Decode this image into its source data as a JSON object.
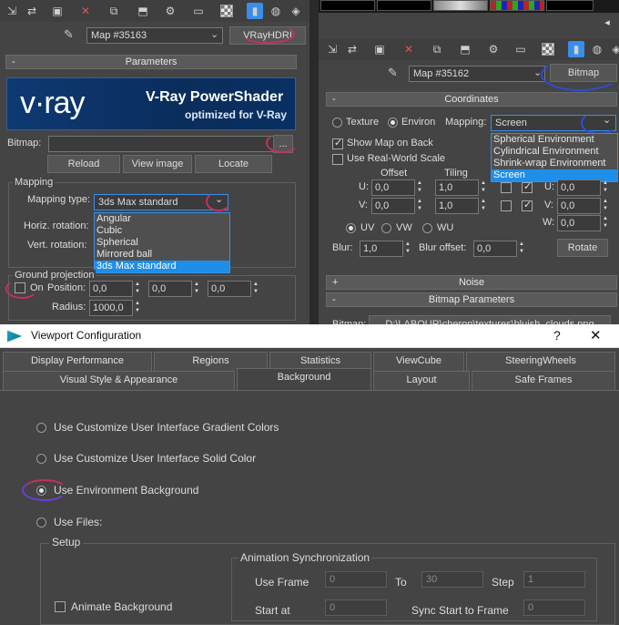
{
  "left_panel": {
    "map_name": "Map #35163",
    "map_type_button": "VRayHDRI",
    "parameters_header": "Parameters",
    "banner": {
      "logo": "v·ray",
      "title": "V-Ray PowerShader",
      "subtitle": "optimized for V-Ray"
    },
    "bitmap_label": "Bitmap:",
    "bitmap_browse": "...",
    "reload_button": "Reload",
    "view_image_button": "View image",
    "locate_button": "Locate",
    "mapping_group": "Mapping",
    "mapping_type_label": "Mapping type:",
    "mapping_type_value": "3ds Max standard",
    "horiz_rotation_label": "Horiz. rotation:",
    "vert_rotation_label": "Vert. rotation:",
    "mapping_options": [
      "Angular",
      "Cubic",
      "Spherical",
      "Mirrored ball",
      "3ds Max standard"
    ],
    "mapping_selected_index": 4,
    "ground_projection_group": "Ground projection",
    "on_label": "On",
    "position_label": "Position:",
    "position_values": [
      "0,0",
      "0,0",
      "0,0"
    ],
    "radius_label": "Radius:",
    "radius_value": "1000,0"
  },
  "right_panel": {
    "map_name": "Map #35162",
    "map_type_button": "Bitmap",
    "coordinates_header": "Coordinates",
    "texture_label": "Texture",
    "environ_label": "Environ",
    "mapping_label": "Mapping:",
    "mapping_value": "Screen",
    "mapping_options": [
      "Spherical Environment",
      "Cylindrical Environment",
      "Shrink-wrap Environment",
      "Screen"
    ],
    "mapping_selected_index": 3,
    "show_map_on_back": "Show Map on Back",
    "use_real_world_scale": "Use Real-World Scale",
    "offset_label": "Offset",
    "tiling_label": "Tiling",
    "u_label": "U:",
    "v_label": "V:",
    "w_label": "W:",
    "offset_u": "0,0",
    "offset_v": "0,0",
    "tiling_u": "1,0",
    "tiling_v": "1,0",
    "angle_u": "0,0",
    "angle_v": "0,0",
    "angle_w": "0,0",
    "uv_label": "UV",
    "vw_label": "VW",
    "wu_label": "WU",
    "blur_label": "Blur:",
    "blur_value": "1,0",
    "blur_offset_label": "Blur offset:",
    "blur_offset_value": "0,0",
    "rotate_button": "Rotate",
    "noise_header": "Noise",
    "bitmap_params_header": "Bitmap Parameters",
    "bitmap_row_label": "Bitmap:",
    "bitmap_path": "D:\\LABOUR\\cheron\\textures\\bluish_clouds.png"
  },
  "dialog": {
    "title": "Viewport Configuration",
    "help": "?",
    "close": "✕",
    "tabs_row1": [
      "Display Performance",
      "Regions",
      "Statistics",
      "ViewCube",
      "SteeringWheels"
    ],
    "tabs_row2": [
      "Visual Style & Appearance",
      "Background",
      "Layout",
      "Safe Frames"
    ],
    "active_tab": "Background",
    "options": [
      "Use Customize User Interface Gradient Colors",
      "Use Customize User Interface Solid Color",
      "Use Environment Background",
      "Use Files:"
    ],
    "selected_option_index": 2,
    "setup_group": "Setup",
    "anim_sync_group": "Animation Synchronization",
    "use_frame_label": "Use Frame",
    "use_frame_value": "0",
    "to_label": "To",
    "to_value": "30",
    "step_label": "Step",
    "step_value": "1",
    "start_at_label": "Start at",
    "start_at_value": "0",
    "sync_start_label": "Sync Start to Frame",
    "sync_start_value": "0",
    "animate_background": "Animate Background"
  },
  "colors": {
    "panel_bg": "#444444",
    "accent_blue": "#3a8ee8",
    "highlight_pink": "#c8305a",
    "highlight_blue": "#2b4fd8"
  }
}
